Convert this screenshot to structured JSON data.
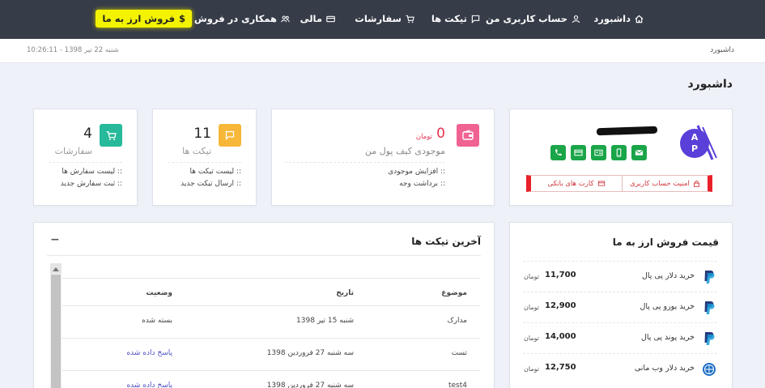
{
  "nav": {
    "dashboard": "داشبورد",
    "account": "حساب کاربری من",
    "tickets": "تیکت ها",
    "orders": "سفارشات",
    "finance": "مالی",
    "affiliate": "همکاری در فروش",
    "sell": "فروش ارز به ما",
    "sell_symbol": "$"
  },
  "breadcrumb": "داشبورد",
  "clock": "شنبه 22 تیر 1398 - 10:26:11",
  "page_title": "داشبورد",
  "profile": {
    "logo_letters": "AP",
    "security_btn": "امنیت حساب کاربری",
    "bankcards_btn": "کارت های بانکی"
  },
  "wallet": {
    "amount": "0",
    "currency": "تومان",
    "label": "موجودی کیف پول من",
    "links": [
      ":: افزایش موجودی",
      ":: برداشت وجه"
    ]
  },
  "tickets_stat": {
    "count": "11",
    "label": "تیکت ها",
    "links": [
      ":: لیست تیکت ها",
      ":: ارسال تیکت جدید"
    ]
  },
  "orders_stat": {
    "count": "4",
    "label": "سفارشات",
    "links": [
      ":: لیست سفارش ها",
      ":: ثبت سفارش جدید"
    ]
  },
  "tickets_table": {
    "title": "آخرین تیکت ها",
    "collapse": "−",
    "columns": [
      "موضوع",
      "تاریخ",
      "وضعیت"
    ],
    "rows": [
      {
        "subject": "مدارک",
        "date": "شنبه 15 تیر 1398",
        "status": "بسته شده"
      },
      {
        "subject": "تست",
        "date": "سه شنبه 27 فروردین 1398",
        "status": "پاسخ داده شده"
      },
      {
        "subject": "test4",
        "date": "سه شنبه 27 فروردین 1398",
        "status": "پاسخ داده شده"
      }
    ]
  },
  "prices": {
    "title": "قیمت فروش ارز به ما",
    "items": [
      {
        "name": "خرید دلار پی پال",
        "value": "11,700",
        "unit": "تومان",
        "icon": "paypal-icon"
      },
      {
        "name": "خرید یورو پی پال",
        "value": "12,900",
        "unit": "تومان",
        "icon": "paypal-icon"
      },
      {
        "name": "خرید پوند پی پال",
        "value": "14,000",
        "unit": "تومان",
        "icon": "paypal-icon"
      },
      {
        "name": "خرید دلار وب مانی",
        "value": "12,750",
        "unit": "تومان",
        "icon": "webmoney-icon"
      }
    ]
  },
  "colors": {
    "nav_bg": "#363c48",
    "sell_highlight": "#f3f300",
    "wallet_pink": "#f06292",
    "ticket_orange": "#f7b739",
    "orders_green": "#26b99a",
    "social_green": "#1aa549",
    "danger_red": "#e8212b",
    "link_blue": "#4a4fc4",
    "paypal_blue": "#253b80"
  }
}
